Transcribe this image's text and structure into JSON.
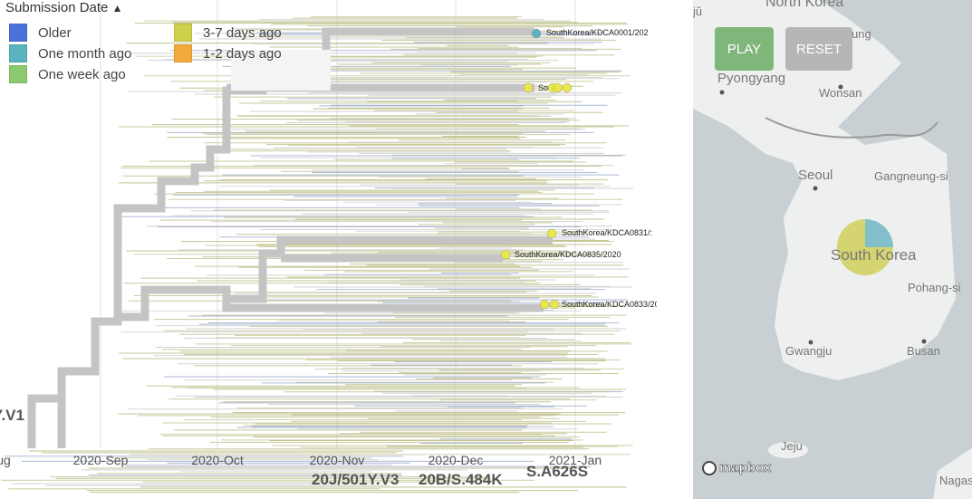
{
  "legend": {
    "title": "Submission Date",
    "toggle_icon": "chevron-up-icon",
    "items": [
      {
        "label": "Older",
        "color": "#4a72d9"
      },
      {
        "label": "One month ago",
        "color": "#5bb3bf"
      },
      {
        "label": "One week ago",
        "color": "#8cc96e"
      },
      {
        "label": "3-7 days ago",
        "color": "#cfd04a"
      },
      {
        "label": "1-2 days ago",
        "color": "#f4a93b"
      }
    ]
  },
  "axis": {
    "ticks": [
      "ug",
      "2020-Sep",
      "2020-Oct",
      "2020-Nov",
      "2020-Dec",
      "2021-Jan"
    ]
  },
  "clades": [
    "Y.V1",
    "20J/501Y.V3",
    "20B/S.484K",
    "S.A626S"
  ],
  "tips": [
    {
      "label": "SouthKorea/KDCA0001/202",
      "color": "#5bb3bf"
    },
    {
      "label": "So",
      "color": "#e8e84a"
    },
    {
      "label": "SouthKorea/KDCA0831/:",
      "color": "#e8e84a"
    },
    {
      "label": "SouthKorea/KDCA0835/2020",
      "color": "#e8e84a"
    },
    {
      "label": "SouthKorea/KDCA0833/20",
      "color": "#e8e84a"
    }
  ],
  "map": {
    "play_label": "PLAY",
    "reset_label": "RESET",
    "play_color": "#7fb67a",
    "reset_color": "#b6b6b6",
    "labels": [
      "North Korea",
      "jŭ",
      "ung",
      "Pyongyang",
      "Wonsan",
      "Seoul",
      "Gangneung-si",
      "South Korea",
      "Pohang-si",
      "Gwangju",
      "Busan",
      "Jeju",
      "Nagas"
    ],
    "pie": {
      "location": "South Korea",
      "slices": [
        {
          "category": "3-7 days ago",
          "fraction": 0.75,
          "color": "#cfcf5a"
        },
        {
          "category": "One month ago",
          "fraction": 0.25,
          "color": "#6fb6c4"
        }
      ]
    },
    "attribution": "mapbox"
  }
}
